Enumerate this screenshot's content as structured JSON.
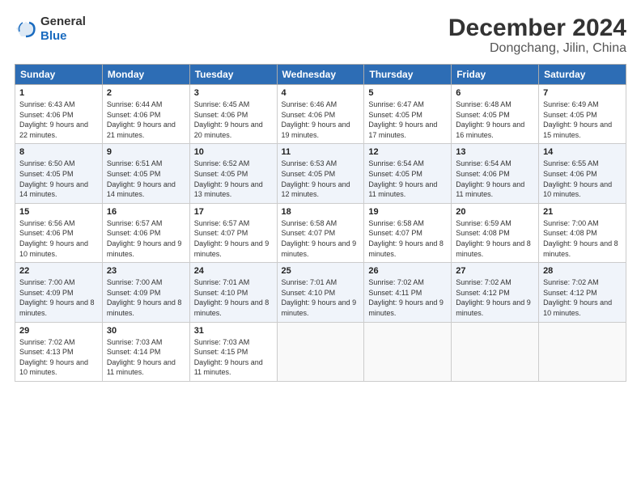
{
  "header": {
    "logo_general": "General",
    "logo_blue": "Blue",
    "title": "December 2024",
    "subtitle": "Dongchang, Jilin, China"
  },
  "weekdays": [
    "Sunday",
    "Monday",
    "Tuesday",
    "Wednesday",
    "Thursday",
    "Friday",
    "Saturday"
  ],
  "weeks": [
    [
      {
        "day": "1",
        "sunrise": "Sunrise: 6:43 AM",
        "sunset": "Sunset: 4:06 PM",
        "daylight": "Daylight: 9 hours and 22 minutes."
      },
      {
        "day": "2",
        "sunrise": "Sunrise: 6:44 AM",
        "sunset": "Sunset: 4:06 PM",
        "daylight": "Daylight: 9 hours and 21 minutes."
      },
      {
        "day": "3",
        "sunrise": "Sunrise: 6:45 AM",
        "sunset": "Sunset: 4:06 PM",
        "daylight": "Daylight: 9 hours and 20 minutes."
      },
      {
        "day": "4",
        "sunrise": "Sunrise: 6:46 AM",
        "sunset": "Sunset: 4:06 PM",
        "daylight": "Daylight: 9 hours and 19 minutes."
      },
      {
        "day": "5",
        "sunrise": "Sunrise: 6:47 AM",
        "sunset": "Sunset: 4:05 PM",
        "daylight": "Daylight: 9 hours and 17 minutes."
      },
      {
        "day": "6",
        "sunrise": "Sunrise: 6:48 AM",
        "sunset": "Sunset: 4:05 PM",
        "daylight": "Daylight: 9 hours and 16 minutes."
      },
      {
        "day": "7",
        "sunrise": "Sunrise: 6:49 AM",
        "sunset": "Sunset: 4:05 PM",
        "daylight": "Daylight: 9 hours and 15 minutes."
      }
    ],
    [
      {
        "day": "8",
        "sunrise": "Sunrise: 6:50 AM",
        "sunset": "Sunset: 4:05 PM",
        "daylight": "Daylight: 9 hours and 14 minutes."
      },
      {
        "day": "9",
        "sunrise": "Sunrise: 6:51 AM",
        "sunset": "Sunset: 4:05 PM",
        "daylight": "Daylight: 9 hours and 14 minutes."
      },
      {
        "day": "10",
        "sunrise": "Sunrise: 6:52 AM",
        "sunset": "Sunset: 4:05 PM",
        "daylight": "Daylight: 9 hours and 13 minutes."
      },
      {
        "day": "11",
        "sunrise": "Sunrise: 6:53 AM",
        "sunset": "Sunset: 4:05 PM",
        "daylight": "Daylight: 9 hours and 12 minutes."
      },
      {
        "day": "12",
        "sunrise": "Sunrise: 6:54 AM",
        "sunset": "Sunset: 4:05 PM",
        "daylight": "Daylight: 9 hours and 11 minutes."
      },
      {
        "day": "13",
        "sunrise": "Sunrise: 6:54 AM",
        "sunset": "Sunset: 4:06 PM",
        "daylight": "Daylight: 9 hours and 11 minutes."
      },
      {
        "day": "14",
        "sunrise": "Sunrise: 6:55 AM",
        "sunset": "Sunset: 4:06 PM",
        "daylight": "Daylight: 9 hours and 10 minutes."
      }
    ],
    [
      {
        "day": "15",
        "sunrise": "Sunrise: 6:56 AM",
        "sunset": "Sunset: 4:06 PM",
        "daylight": "Daylight: 9 hours and 10 minutes."
      },
      {
        "day": "16",
        "sunrise": "Sunrise: 6:57 AM",
        "sunset": "Sunset: 4:06 PM",
        "daylight": "Daylight: 9 hours and 9 minutes."
      },
      {
        "day": "17",
        "sunrise": "Sunrise: 6:57 AM",
        "sunset": "Sunset: 4:07 PM",
        "daylight": "Daylight: 9 hours and 9 minutes."
      },
      {
        "day": "18",
        "sunrise": "Sunrise: 6:58 AM",
        "sunset": "Sunset: 4:07 PM",
        "daylight": "Daylight: 9 hours and 9 minutes."
      },
      {
        "day": "19",
        "sunrise": "Sunrise: 6:58 AM",
        "sunset": "Sunset: 4:07 PM",
        "daylight": "Daylight: 9 hours and 8 minutes."
      },
      {
        "day": "20",
        "sunrise": "Sunrise: 6:59 AM",
        "sunset": "Sunset: 4:08 PM",
        "daylight": "Daylight: 9 hours and 8 minutes."
      },
      {
        "day": "21",
        "sunrise": "Sunrise: 7:00 AM",
        "sunset": "Sunset: 4:08 PM",
        "daylight": "Daylight: 9 hours and 8 minutes."
      }
    ],
    [
      {
        "day": "22",
        "sunrise": "Sunrise: 7:00 AM",
        "sunset": "Sunset: 4:09 PM",
        "daylight": "Daylight: 9 hours and 8 minutes."
      },
      {
        "day": "23",
        "sunrise": "Sunrise: 7:00 AM",
        "sunset": "Sunset: 4:09 PM",
        "daylight": "Daylight: 9 hours and 8 minutes."
      },
      {
        "day": "24",
        "sunrise": "Sunrise: 7:01 AM",
        "sunset": "Sunset: 4:10 PM",
        "daylight": "Daylight: 9 hours and 8 minutes."
      },
      {
        "day": "25",
        "sunrise": "Sunrise: 7:01 AM",
        "sunset": "Sunset: 4:10 PM",
        "daylight": "Daylight: 9 hours and 9 minutes."
      },
      {
        "day": "26",
        "sunrise": "Sunrise: 7:02 AM",
        "sunset": "Sunset: 4:11 PM",
        "daylight": "Daylight: 9 hours and 9 minutes."
      },
      {
        "day": "27",
        "sunrise": "Sunrise: 7:02 AM",
        "sunset": "Sunset: 4:12 PM",
        "daylight": "Daylight: 9 hours and 9 minutes."
      },
      {
        "day": "28",
        "sunrise": "Sunrise: 7:02 AM",
        "sunset": "Sunset: 4:12 PM",
        "daylight": "Daylight: 9 hours and 10 minutes."
      }
    ],
    [
      {
        "day": "29",
        "sunrise": "Sunrise: 7:02 AM",
        "sunset": "Sunset: 4:13 PM",
        "daylight": "Daylight: 9 hours and 10 minutes."
      },
      {
        "day": "30",
        "sunrise": "Sunrise: 7:03 AM",
        "sunset": "Sunset: 4:14 PM",
        "daylight": "Daylight: 9 hours and 11 minutes."
      },
      {
        "day": "31",
        "sunrise": "Sunrise: 7:03 AM",
        "sunset": "Sunset: 4:15 PM",
        "daylight": "Daylight: 9 hours and 11 minutes."
      },
      null,
      null,
      null,
      null
    ]
  ]
}
